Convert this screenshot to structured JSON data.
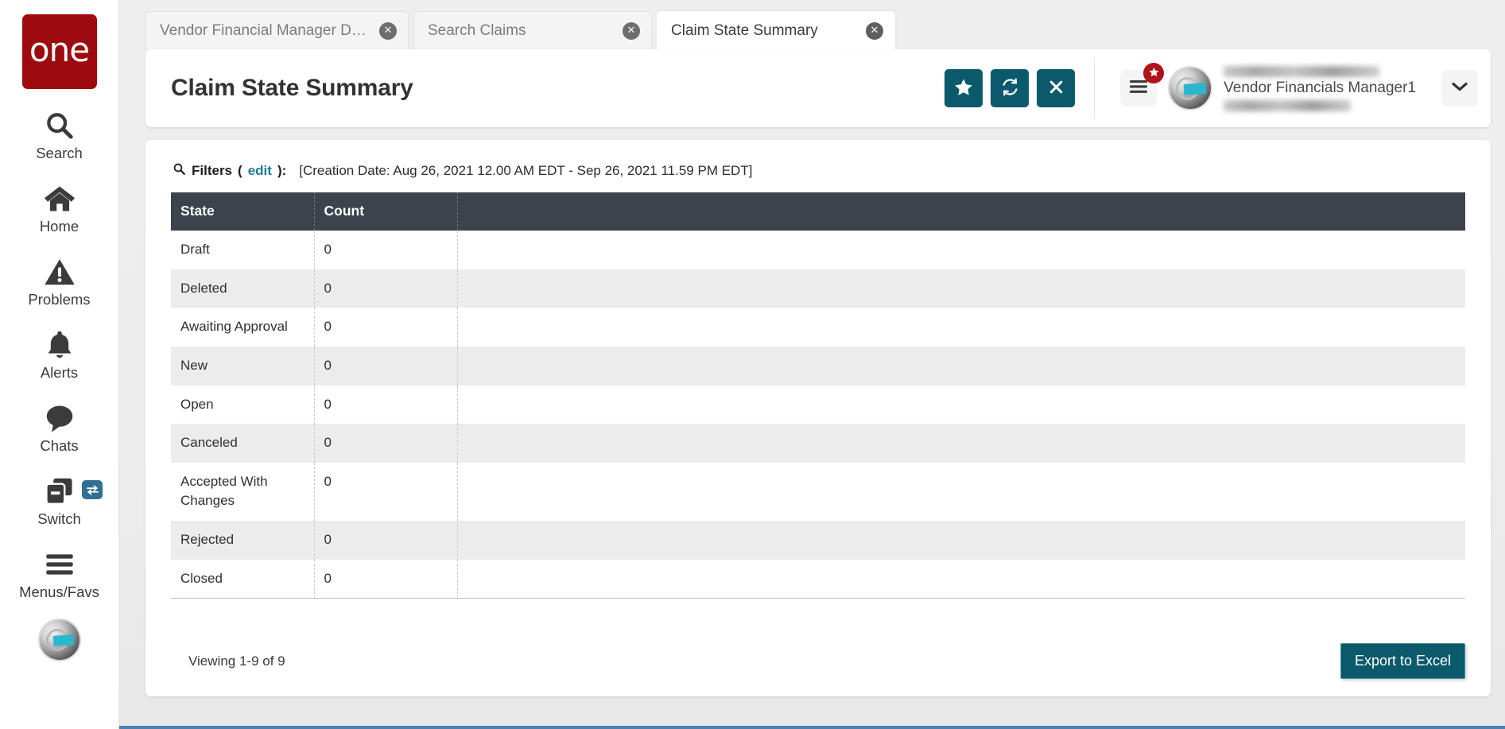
{
  "sidebar": {
    "logo_text": "one",
    "items": [
      {
        "icon": "search-icon",
        "label": "Search"
      },
      {
        "icon": "home-icon",
        "label": "Home"
      },
      {
        "icon": "warning-triangle-icon",
        "label": "Problems"
      },
      {
        "icon": "bell-icon",
        "label": "Alerts"
      },
      {
        "icon": "chat-bubble-icon",
        "label": "Chats"
      },
      {
        "icon": "switch-windows-icon",
        "label": "Switch"
      },
      {
        "icon": "hamburger-icon",
        "label": "Menus/Favs"
      }
    ],
    "switch_badge_icon": "swap-arrows-icon",
    "avatar_icon": "user-avatar"
  },
  "tabs": [
    {
      "label": "Vendor Financial Manager Dash...",
      "active": false,
      "close_icon": "close-circle-icon"
    },
    {
      "label": "Search Claims",
      "active": false,
      "close_icon": "close-circle-icon"
    },
    {
      "label": "Claim State Summary",
      "active": true,
      "close_icon": "close-circle-icon"
    }
  ],
  "header": {
    "title": "Claim State Summary",
    "actions": [
      {
        "name": "favorite-button",
        "icon": "star-icon"
      },
      {
        "name": "refresh-button",
        "icon": "refresh-icon"
      },
      {
        "name": "close-button",
        "icon": "x-icon"
      }
    ],
    "menu_button_icon": "hamburger-icon",
    "menu_badge_icon": "star-icon",
    "user": {
      "name_redacted": true,
      "role": "Vendor Financials Manager1",
      "caret_icon": "chevron-down-icon",
      "avatar_icon": "user-avatar"
    }
  },
  "filters": {
    "icon": "search-icon",
    "label": "Filters",
    "open_paren": "(",
    "edit_link": "edit",
    "close_paren": "):",
    "value": "[Creation Date: Aug 26, 2021 12.00 AM EDT - Sep 26, 2021 11.59 PM EDT]"
  },
  "table": {
    "columns": [
      "State",
      "Count",
      ""
    ],
    "rows": [
      {
        "state": "Draft",
        "count": "0"
      },
      {
        "state": "Deleted",
        "count": "0"
      },
      {
        "state": "Awaiting Approval",
        "count": "0"
      },
      {
        "state": "New",
        "count": "0"
      },
      {
        "state": "Open",
        "count": "0"
      },
      {
        "state": "Canceled",
        "count": "0"
      },
      {
        "state": "Accepted With Changes",
        "count": "0"
      },
      {
        "state": "Rejected",
        "count": "0"
      },
      {
        "state": "Closed",
        "count": "0"
      }
    ]
  },
  "footer": {
    "viewing_text": "Viewing 1-9 of 9",
    "export_label": "Export to Excel"
  },
  "colors": {
    "brand_red": "#9e0b0f",
    "teal_action": "#0b5a6b",
    "table_header": "#3c434d",
    "link_blue": "#1a7c99",
    "badge_red": "#b1121a",
    "bottom_bar_blue": "#4a7fb5"
  }
}
